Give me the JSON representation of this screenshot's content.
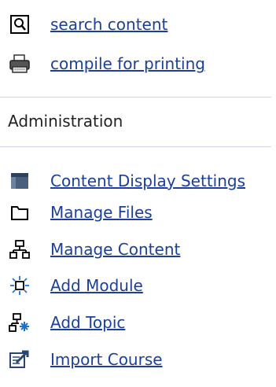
{
  "links": {
    "search": "search content",
    "compile": "compile for printing"
  },
  "admin": {
    "title": "Administration",
    "items": [
      {
        "label": "Content Display Settings",
        "icon": "content-display-settings-icon"
      },
      {
        "label": "Manage Files",
        "icon": "folder-icon"
      },
      {
        "label": "Manage Content",
        "icon": "tree-structure-icon"
      },
      {
        "label": "Add Module",
        "icon": "add-module-icon"
      },
      {
        "label": "Add Topic",
        "icon": "add-topic-icon"
      },
      {
        "label": "Import Course",
        "icon": "import-course-icon"
      }
    ]
  },
  "colors": {
    "link": "#1b3f9a",
    "divider": "#cfd6e3"
  }
}
